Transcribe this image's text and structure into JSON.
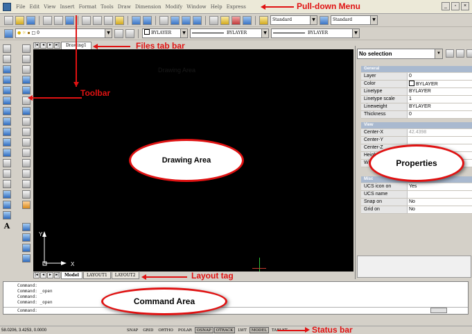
{
  "menubar": {
    "items": [
      "File",
      "Edit",
      "View",
      "Insert",
      "Format",
      "Tools",
      "Draw",
      "Dimension",
      "Modify",
      "Window",
      "Help",
      "Express"
    ]
  },
  "toolbar1": {
    "text_style": "Standard",
    "dim_style": "Standard"
  },
  "toolbar2": {
    "layer": "0",
    "color": "BYLAYER",
    "linetype": "BYLAYER",
    "lineweight": "BYLAYER"
  },
  "file_tabs": [
    "Drawing1"
  ],
  "layout_tabs": [
    "Model",
    "LAYOUT1",
    "LAYOUT2"
  ],
  "drawing": {
    "faint_text": "Drawing Area",
    "ucs_x": "X",
    "ucs_y": "Y"
  },
  "properties": {
    "selection": "No selection",
    "sections": {
      "general": "General",
      "view": "View",
      "misc": "Misc"
    },
    "general_rows": [
      {
        "key": "Layer",
        "value": "0"
      },
      {
        "key": "Color",
        "value": "BYLAYER"
      },
      {
        "key": "Linetype",
        "value": "BYLAYER"
      },
      {
        "key": "Linetype scale",
        "value": "1"
      },
      {
        "key": "Lineweight",
        "value": "BYLAYER"
      },
      {
        "key": "Thickness",
        "value": "0"
      }
    ],
    "view_rows": [
      {
        "key": "Center-X",
        "value": "42.4398"
      },
      {
        "key": "Center-Y",
        "value": ""
      },
      {
        "key": "Center-Z",
        "value": ""
      },
      {
        "key": "Height",
        "value": ""
      },
      {
        "key": "Width",
        "value": ""
      }
    ],
    "misc_rows": [
      {
        "key": "UCS icon on",
        "value": "Yes"
      },
      {
        "key": "UCS name",
        "value": ""
      },
      {
        "key": "Snap on",
        "value": "No"
      },
      {
        "key": "Grid on",
        "value": "No"
      }
    ]
  },
  "command": {
    "history": [
      "Command:",
      "Command: _open",
      "Command:",
      "Command: _open"
    ],
    "prompt": "Command:"
  },
  "statusbar": {
    "coords": "58.0206, 3.4253, 0.0000",
    "buttons": [
      {
        "label": "SNAP",
        "on": false
      },
      {
        "label": "GRID",
        "on": false
      },
      {
        "label": "ORTHO",
        "on": false
      },
      {
        "label": "POLAR",
        "on": false
      },
      {
        "label": "OSNAP",
        "on": true
      },
      {
        "label": "OTRACK",
        "on": true
      },
      {
        "label": "LWT",
        "on": false
      },
      {
        "label": "MODEL",
        "on": true
      },
      {
        "label": "TABLET",
        "on": false
      }
    ]
  },
  "annotations": {
    "pulldown": "Pull-down Menu",
    "filestab": "Files tab bar",
    "toolbar": "Toolbar",
    "drawing_area": "Drawing Area",
    "properties": "Properties",
    "layout": "Layout tag",
    "command_area": "Command Area",
    "status": "Status bar"
  },
  "colors": {
    "annotation": "#e01212",
    "drawing_bg": "#000000",
    "ui_face": "#d4d0c8"
  }
}
